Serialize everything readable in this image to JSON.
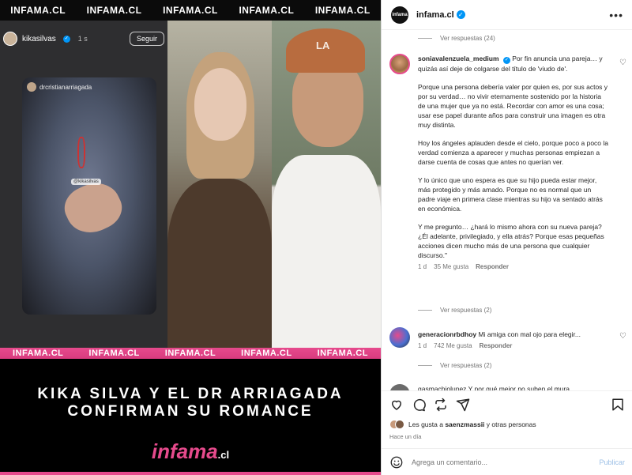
{
  "post_image": {
    "watermark_top": [
      "INFAMA.CL",
      "INFAMA.CL",
      "INFAMA.CL",
      "INFAMA.CL",
      "INFAMA.CL"
    ],
    "watermark_bottom": [
      "INFAMA.CL",
      "INFAMA.CL",
      "INFAMA.CL",
      "INFAMA.CL",
      "INFAMA.CL"
    ],
    "story": {
      "username": "kikasilvas",
      "time": "1 s",
      "follow_label": "Seguir",
      "tag": "drcristianarriagada",
      "sticker": "@kikasilvas"
    },
    "cap_logo": "LA",
    "headline_line1": "KIKA SILVA Y EL DR ARRIAGADA",
    "headline_line2": "CONFIRMAN SU ROMANCE",
    "brand_main": "infama",
    "brand_suffix": ".cl"
  },
  "panel": {
    "header": {
      "avatar_text": "infama",
      "username": "infama.cl",
      "verified": "✓",
      "more": "•••"
    },
    "comments": {
      "replies_top": "Ver respuestas (24)",
      "main_comment": {
        "username": "soniavalenzuela_medium",
        "verified": "✓",
        "paragraphs": [
          "Por fin anuncia una pareja… y quizás así deje de colgarse del título de 'viudo de'.",
          "Porque una persona debería valer por quien es, por sus actos y por su verdad… no vivir eternamente sostenido por la historia de una mujer que ya no está. Recordar con amor es una cosa; usar ese papel durante años para construir una imagen es otra muy distinta.",
          "Hoy los ángeles aplauden desde el cielo, porque poco a poco la verdad comienza a aparecer y muchas personas empiezan a darse cuenta de cosas que antes no querían ver.",
          "Y lo único que uno espera es que su hijo pueda estar mejor, más protegido y más amado. Porque no es normal que un padre viaje en primera clase mientras su hijo va sentado atrás en económica.",
          "Y me pregunto… ¿hará lo mismo ahora con su nueva pareja? ¿Él adelante, privilegiado, y ella atrás? Porque esas pequeñas acciones dicen mucho más de una persona que cualquier discurso.\""
        ],
        "time": "1 d",
        "likes": "35 Me gusta",
        "reply": "Responder",
        "replies": "Ver respuestas (2)"
      },
      "second_comment": {
        "username": "generacionrbdhoy",
        "text": "Mi amiga con mal ojo para elegir...",
        "time": "1 d",
        "likes": "742 Me gusta",
        "reply": "Responder",
        "replies": "Ver respuestas (2)"
      },
      "partial_comment": "gasmachiolunez Y por qué mejor no suben el mura"
    },
    "actions": {
      "liked_by_prefix": "Les gusta a",
      "liked_by_user": "saenzmassii",
      "liked_by_suffix": "y otras personas",
      "posted_ago": "Hace un día",
      "comment_placeholder": "Agrega un comentario...",
      "publish_label": "Publicar"
    }
  },
  "colors": {
    "brand_pink": "#e64a8c",
    "verified_blue": "#0095f6",
    "publish_disabled": "#9bbfe6"
  }
}
